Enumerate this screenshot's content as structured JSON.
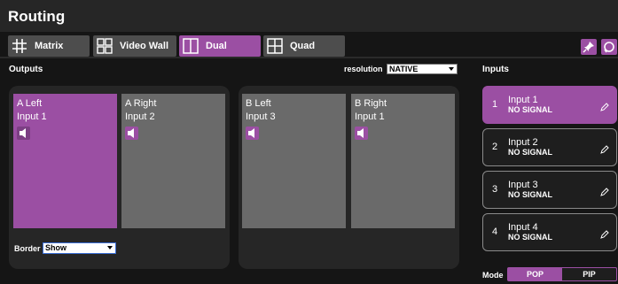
{
  "window": {
    "title": "Routing"
  },
  "tabs": [
    {
      "label": "Matrix",
      "icon": "matrix-grid-icon",
      "active": false
    },
    {
      "label": "Video Wall",
      "icon": "video-wall-icon",
      "active": false
    },
    {
      "label": "Dual",
      "icon": "dual-split-icon",
      "active": true
    },
    {
      "label": "Quad",
      "icon": "quad-split-icon",
      "active": false
    }
  ],
  "toolbar": {
    "pin_icon": "pin-icon",
    "refresh_icon": "refresh-icon"
  },
  "outputs": {
    "heading": "Outputs",
    "resolution_label": "resolution",
    "resolution_value": "NATIVE",
    "groups": [
      {
        "panels": [
          {
            "name": "A Left",
            "input": "Input 1",
            "selected": true
          },
          {
            "name": "A Right",
            "input": "Input 2",
            "selected": false
          }
        ]
      },
      {
        "panels": [
          {
            "name": "B Left",
            "input": "Input 3",
            "selected": false
          },
          {
            "name": "B Right",
            "input": "Input 1",
            "selected": false
          }
        ]
      }
    ],
    "border_label": "Border",
    "border_value": "Show"
  },
  "inputs": {
    "heading": "Inputs",
    "items": [
      {
        "number": "1",
        "name": "Input 1",
        "status": "NO SIGNAL",
        "selected": true
      },
      {
        "number": "2",
        "name": "Input 2",
        "status": "NO SIGNAL",
        "selected": false
      },
      {
        "number": "3",
        "name": "Input 3",
        "status": "NO SIGNAL",
        "selected": false
      },
      {
        "number": "4",
        "name": "Input 4",
        "status": "NO SIGNAL",
        "selected": false
      }
    ]
  },
  "mode": {
    "label": "Mode",
    "options": [
      {
        "label": "POP",
        "active": true
      },
      {
        "label": "PIP",
        "active": false
      }
    ]
  },
  "colors": {
    "accent": "#9b4fa3",
    "panel": "#6a6a6a",
    "background": "#151515",
    "group": "#262626"
  }
}
